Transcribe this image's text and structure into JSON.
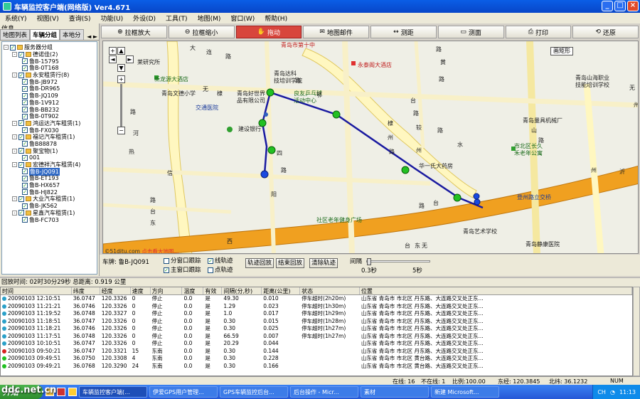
{
  "window": {
    "title": "车辆监控客户端(网络版) Ver4.671"
  },
  "menu": [
    "系统(Y)",
    "视图(V)",
    "查询(S)",
    "功能(U)",
    "外设(D)",
    "工具(T)",
    "地图(M)",
    "窗口(W)",
    "帮助(H)"
  ],
  "left_panel": {
    "title": "信息",
    "tabs": [
      "地图列表",
      "车辆分组",
      "本地分"
    ],
    "active_tab": 1,
    "tree": [
      {
        "level": 0,
        "label": "服务器分组",
        "exp": "-"
      },
      {
        "level": 1,
        "label": "德诺佳(2)",
        "exp": "-"
      },
      {
        "level": 2,
        "label": "鲁B-15795"
      },
      {
        "level": 2,
        "label": "鲁B-0T168"
      },
      {
        "level": 1,
        "label": "永安租赁行(8)",
        "exp": "-"
      },
      {
        "level": 2,
        "label": "鲁B-JB972"
      },
      {
        "level": 2,
        "label": "鲁B-DR965"
      },
      {
        "level": 2,
        "label": "鲁B-JQ109"
      },
      {
        "level": 2,
        "label": "鲁B-1V912"
      },
      {
        "level": 2,
        "label": "鲁B-BB232"
      },
      {
        "level": 2,
        "label": "鲁B-0T902"
      },
      {
        "level": 1,
        "label": "鸿运达汽车租赁(1)",
        "exp": "-"
      },
      {
        "level": 2,
        "label": "鲁B-FX030"
      },
      {
        "level": 1,
        "label": "福记汽车租赁(1)",
        "exp": "-"
      },
      {
        "level": 2,
        "label": "鲁B88878"
      },
      {
        "level": 1,
        "label": "聚宝物(1)",
        "exp": "-"
      },
      {
        "level": 2,
        "label": "001"
      },
      {
        "level": 1,
        "label": "宏德祥汽车租赁(4)",
        "exp": "-"
      },
      {
        "level": 2,
        "label": "鲁B-JQ091",
        "selected": true
      },
      {
        "level": 2,
        "label": "鲁B-ET193"
      },
      {
        "level": 2,
        "label": "鲁B-HX657"
      },
      {
        "level": 2,
        "label": "鲁B-HJ822"
      },
      {
        "level": 1,
        "label": "大业汽车租赁(1)",
        "exp": "-"
      },
      {
        "level": 2,
        "label": "鲁B-JK562"
      },
      {
        "level": 1,
        "label": "星鑫汽车租赁(1)",
        "exp": "-"
      },
      {
        "level": 2,
        "label": "鲁B-FC703"
      }
    ]
  },
  "toolbar": [
    {
      "label": "拉框放大",
      "icon": "zoom-in-icon"
    },
    {
      "label": "拉框缩小",
      "icon": "zoom-out-icon"
    },
    {
      "label": "拖动",
      "icon": "pan-icon",
      "active": true
    },
    {
      "label": "地图邮件",
      "icon": "map-mail-icon"
    },
    {
      "label": "测距",
      "icon": "measure-icon"
    },
    {
      "label": "测面",
      "icon": "area-icon"
    },
    {
      "label": "打印",
      "icon": "print-icon"
    },
    {
      "label": "还原",
      "icon": "restore-icon"
    }
  ],
  "map": {
    "ruler_label": "画矩形",
    "copyright": "©51ditu.com",
    "copyright_link": "点击看大地图...",
    "labels": [
      {
        "t": "青岛市第十中",
        "c": "r"
      },
      {
        "t": "永泰阁大酒店",
        "c": "r"
      },
      {
        "t": "新龙源大酒店",
        "c": "g"
      },
      {
        "t": "青岛达科",
        "c": ""
      },
      {
        "t": "技培训学院",
        "c": ""
      },
      {
        "t": "青岛山海职业",
        "c": ""
      },
      {
        "t": "技能培训学校",
        "c": ""
      },
      {
        "t": "青岛文德小学",
        "c": ""
      },
      {
        "t": "青岛好世界",
        "c": ""
      },
      {
        "t": "品有限公司",
        "c": ""
      },
      {
        "t": "良友乒乓球",
        "c": "g"
      },
      {
        "t": "活动中心",
        "c": "g"
      },
      {
        "t": "交通医院",
        "c": "b"
      },
      {
        "t": "建设银行",
        "c": ""
      },
      {
        "t": "青岛量具机械厂",
        "c": ""
      },
      {
        "t": "市北区长久",
        "c": "g"
      },
      {
        "t": "禾老年公寓",
        "c": "g"
      },
      {
        "t": "华一氏大药房",
        "c": ""
      },
      {
        "t": "登州路立交桥",
        "c": "b"
      },
      {
        "t": "社区老年健身广场",
        "c": "g"
      },
      {
        "t": "青岛艺术学校",
        "c": ""
      },
      {
        "t": "青岛静康医院",
        "c": ""
      },
      {
        "t": "莱研究所",
        "c": ""
      }
    ],
    "street_chars": [
      "大",
      "连",
      "路",
      "无",
      "棣",
      "四",
      "路",
      "阳",
      "信",
      "路",
      "河",
      "热",
      "路",
      "台",
      "东",
      "路",
      "黄",
      "台",
      "路",
      "较",
      "州",
      "路",
      "州",
      "沂",
      "路",
      "台",
      "西",
      "路",
      "无",
      "棣",
      "路",
      "鄂",
      "州",
      "路",
      "水",
      "山",
      "路",
      "台",
      "东",
      "无",
      "州"
    ]
  },
  "controls": {
    "plate_label": "车牌: 鲁B-JQ091",
    "check_split": "分窗口跟踪",
    "check_main": "主窗口跟踪",
    "check_line": "线轨迹",
    "check_point": "点轨迹",
    "btn_replay": "轨迹回放",
    "btn_end": "结束回放",
    "btn_clear": "清除轨迹",
    "interval_label": "间隔",
    "interval_min": "0.3秒",
    "interval_max": "5秒"
  },
  "info": {
    "text": "回放时间: 02时30分29秒  总距离: 0.919 公里"
  },
  "table": {
    "columns": [
      "时间",
      "纬度",
      "经度",
      "速度",
      "方向",
      "温度",
      "有效",
      "间隔(分,秒)",
      "距离(公里)",
      "状态",
      "位置"
    ],
    "rows": [
      {
        "dot": "#2aa0c8",
        "cells": [
          "20090103 12:10:51",
          "36.0747",
          "120.3326",
          "0",
          "停止",
          "0.0",
          "是",
          "49.30",
          "0.010",
          "停车超时(2h20m)",
          "山东省 青岛市 市北区 丹东路、大连路交叉处正东..."
        ]
      },
      {
        "dot": "#2aa0c8",
        "cells": [
          "20090103 11:21:21",
          "36.0746",
          "120.3326",
          "0",
          "停止",
          "0.0",
          "是",
          "1.29",
          "0.023",
          "停车超时(1h30m)",
          "山东省 青岛市 市北区 丹东路、大连路交叉处正东..."
        ]
      },
      {
        "dot": "#2aa0c8",
        "cells": [
          "20090103 11:19:52",
          "36.0748",
          "120.3327",
          "0",
          "停止",
          "0.0",
          "是",
          "1.0",
          "0.017",
          "停车超时(1h29m)",
          "山东省 青岛市 市北区 丹东路、大连路交叉处正东..."
        ]
      },
      {
        "dot": "#2aa0c8",
        "cells": [
          "20090103 11:18:51",
          "36.0747",
          "120.3326",
          "0",
          "停止",
          "0.0",
          "是",
          "0.30",
          "0.015",
          "停车超时(1h28m)",
          "山东省 青岛市 市北区 丹东路、大连路交叉处正东..."
        ]
      },
      {
        "dot": "#2aa0c8",
        "cells": [
          "20090103 11:18:21",
          "36.0746",
          "120.3326",
          "0",
          "停止",
          "0.0",
          "是",
          "0.30",
          "0.025",
          "停车超时(1h27m)",
          "山东省 青岛市 市北区 丹东路、大连路交叉处正东..."
        ]
      },
      {
        "dot": "#2aa0c8",
        "cells": [
          "20090103 11:17:51",
          "36.0748",
          "120.3326",
          "0",
          "停止",
          "0.0",
          "是",
          "66.59",
          "0.007",
          "停车超时(1h27m)",
          "山东省 青岛市 市北区 丹东路、大连路交叉处正东..."
        ]
      },
      {
        "dot": "#2aa0c8",
        "cells": [
          "20090103 10:10:51",
          "36.0747",
          "120.3326",
          "0",
          "停止",
          "0.0",
          "是",
          "20.29",
          "0.044",
          "",
          "山东省 青岛市 市北区 丹东路、大连路交叉处正东..."
        ]
      },
      {
        "dot": "#d82020",
        "cells": [
          "20090103 09:50:21",
          "36.0747",
          "120.3321",
          "15",
          "东南",
          "0.0",
          "是",
          "0.30",
          "0.144",
          "",
          "山东省 青岛市 市北区 丹东路、大连路交叉处正东..."
        ]
      },
      {
        "dot": "#22c022",
        "cells": [
          "20090103 09:49:51",
          "36.0750",
          "120.3308",
          "4",
          "东南",
          "0.0",
          "是",
          "0.30",
          "0.228",
          "",
          "山东省 青岛市 市北区 黄台路、大连路交叉处正东..."
        ]
      },
      {
        "dot": "#22c022",
        "cells": [
          "20090103 09:49:21",
          "36.0768",
          "120.3290",
          "24",
          "东南",
          "0.0",
          "是",
          "0.30",
          "0.166",
          "",
          "山东省 青岛市 市北区 黄台路、大连路交叉处正东..."
        ]
      }
    ]
  },
  "status": {
    "online": "在线: 16",
    "offline": "不在线: 1",
    "scale": "比例:100.00",
    "east": "东经: 120.3845",
    "north": "北纬: 36.1232",
    "num": "NUM"
  },
  "taskbar": {
    "start": "开始",
    "tasks": [
      {
        "label": "车辆监控客户端(...",
        "active": true
      },
      {
        "label": "伊爱GPS用户管理..."
      },
      {
        "label": "GPS车辆监控后台..."
      },
      {
        "label": "后台操作 - Micr..."
      },
      {
        "label": "素材"
      },
      {
        "label": "新建 Microsoft..."
      }
    ],
    "lang": "CH",
    "clock": "11:13"
  },
  "watermark": "ddc.net.cn"
}
